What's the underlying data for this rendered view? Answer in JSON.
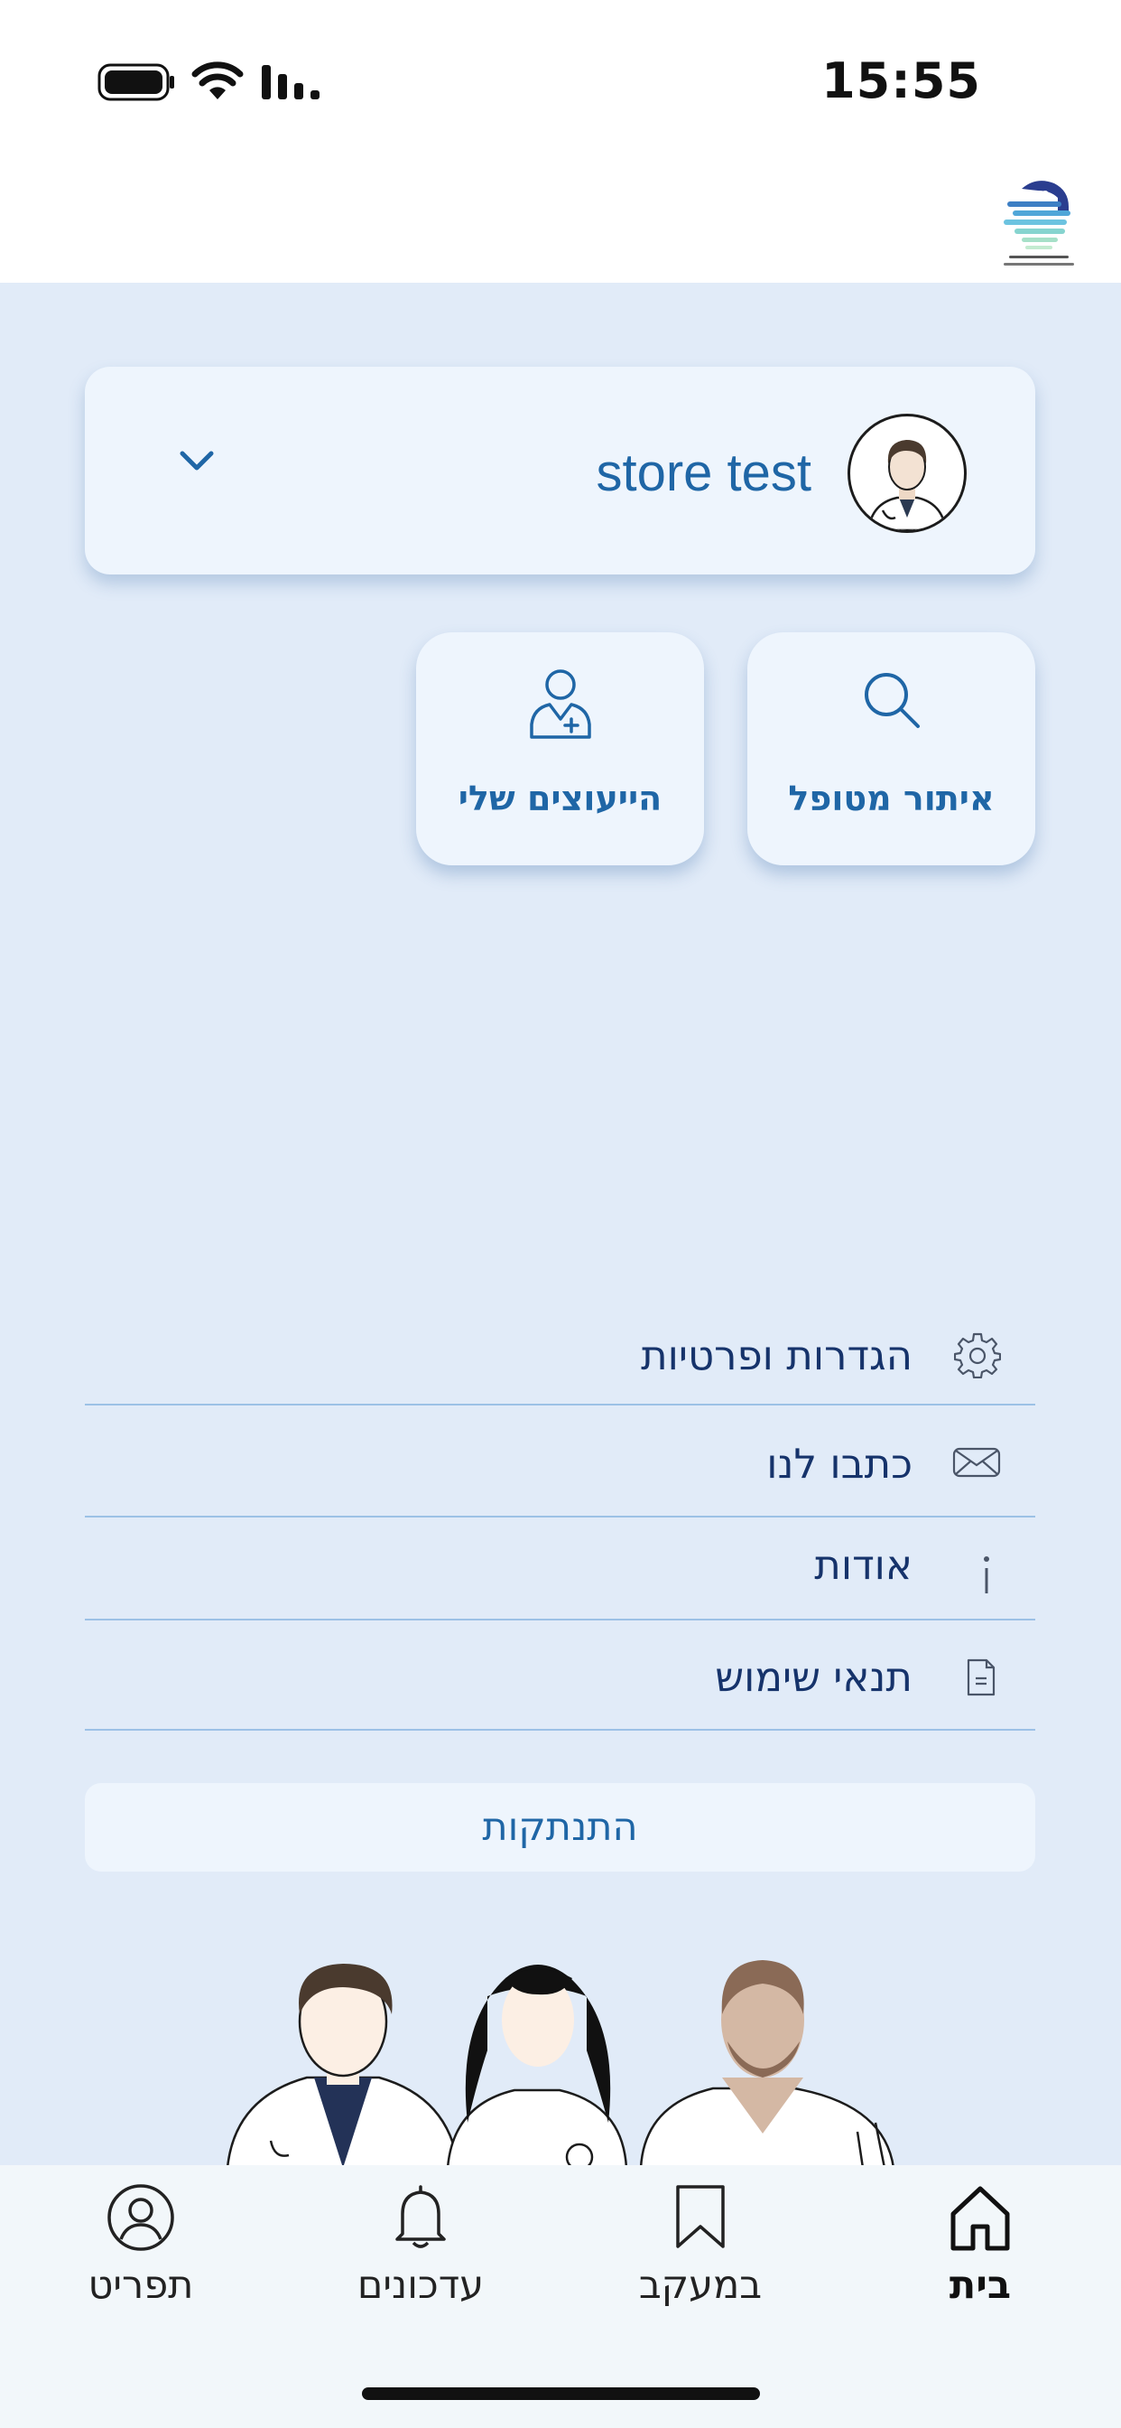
{
  "status_bar": {
    "time": "15:55"
  },
  "user": {
    "name": "store test"
  },
  "tiles": [
    {
      "id": "find",
      "label": "איתור מטופל",
      "icon": "search-icon"
    },
    {
      "id": "advisors",
      "label": "הייעוצים שלי",
      "icon": "medical-user-icon"
    }
  ],
  "menu": {
    "items": [
      {
        "label": "הגדרות ופרטיות",
        "icon": "gear-icon"
      },
      {
        "label": "כתבו לנו",
        "icon": "envelope-icon"
      },
      {
        "label": "אודות",
        "icon": "info-icon"
      },
      {
        "label": "תנאי שימוש",
        "icon": "document-icon"
      }
    ],
    "logout_label": "התנתקות"
  },
  "tabbar": {
    "items": [
      {
        "label": "בית",
        "icon": "home-icon",
        "active": true
      },
      {
        "label": "במעקב",
        "icon": "bookmark-icon",
        "active": false
      },
      {
        "label": "עדכונים",
        "icon": "bell-icon",
        "active": false
      },
      {
        "label": "תפריט",
        "icon": "user-circle-icon",
        "active": false
      }
    ]
  },
  "colors": {
    "background": "#e1ebf8",
    "card": "#eef5fd",
    "accent": "#1f66a6",
    "menu_text": "#16336b",
    "divider": "#9cc1e6"
  }
}
